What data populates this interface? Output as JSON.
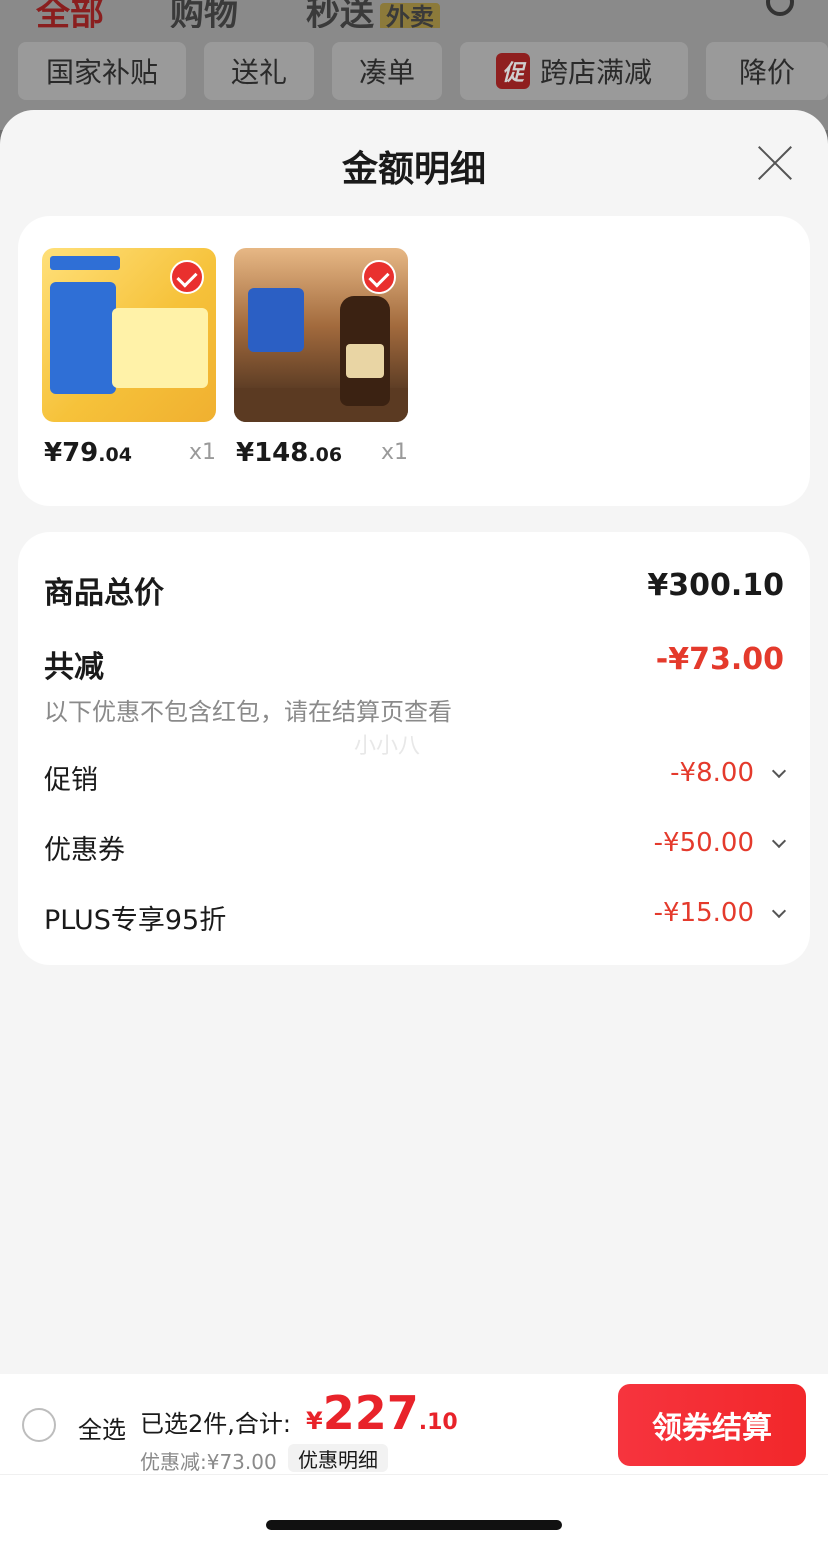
{
  "background": {
    "tabs": [
      "全部",
      "购物",
      "秒送"
    ],
    "tab_badge": "外卖",
    "chips": [
      "国家补贴",
      "送礼",
      "凑单",
      "跨店满减",
      "降价"
    ],
    "promo_tag": "促"
  },
  "sheet": {
    "title": "金额明细"
  },
  "products": [
    {
      "price_symbol": "¥",
      "price_int": "79",
      "price_dec": ".04",
      "qty": "x1"
    },
    {
      "price_symbol": "¥",
      "price_int": "148",
      "price_dec": ".06",
      "qty": "x1"
    }
  ],
  "summary": {
    "total_label": "商品总价",
    "total_value": "¥300.10",
    "reduce_label": "共减",
    "reduce_value": "-¥73.00",
    "note": "以下优惠不包含红包，请在结算页查看",
    "watermark": "小小八",
    "items": [
      {
        "label": "促销",
        "value": "-¥8.00"
      },
      {
        "label": "优惠券",
        "value": "-¥50.00"
      },
      {
        "label": "PLUS专享95折",
        "value": "-¥15.00"
      }
    ]
  },
  "bottom": {
    "select_all": "全选",
    "selected_text": "已选2件,合计:",
    "total_symbol": "¥",
    "total_int": "227",
    "total_dec": ".10",
    "discount_text": "优惠减:¥73.00",
    "detail_label": "优惠明细",
    "checkout_label": "领券结算"
  },
  "colors": {
    "accent_red": "#e8232a",
    "sheet_bg": "#f5f5f5"
  }
}
